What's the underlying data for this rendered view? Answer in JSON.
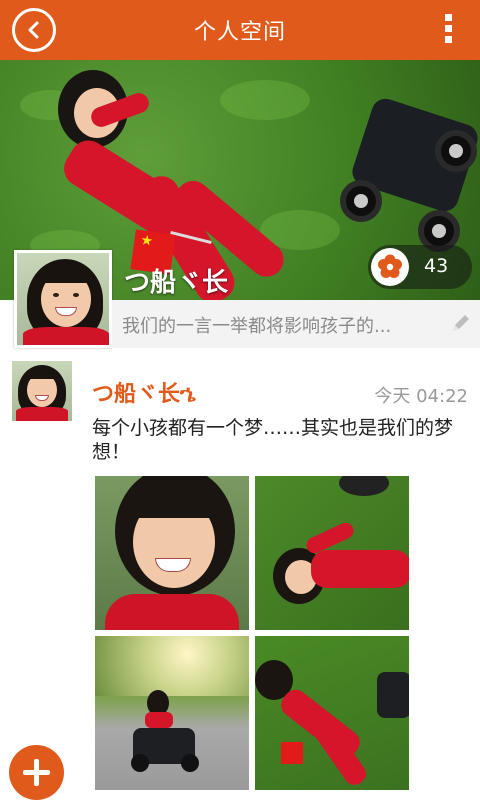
{
  "header": {
    "title": "个人空间",
    "back_icon": "back-arrow-icon",
    "menu_icon": "more-vertical-icon"
  },
  "profile": {
    "username": "つ船ヾ长",
    "signature": "我们的一言一举都将影响孩子的...",
    "flower_count": "43",
    "flower_icon": "flower-icon",
    "edit_icon": "pencil-icon"
  },
  "post": {
    "author": "つ船ヾ长ኄ",
    "time": "今天 04:22",
    "text": "每个小孩都有一个梦……其实也是我们的梦想！",
    "photos": [
      "photo-1",
      "photo-2",
      "photo-3",
      "photo-4"
    ]
  },
  "fab": {
    "icon": "plus-icon"
  },
  "colors": {
    "accent": "#e05a1b",
    "grass": "#3f7d22",
    "shirt": "#d4152a"
  }
}
